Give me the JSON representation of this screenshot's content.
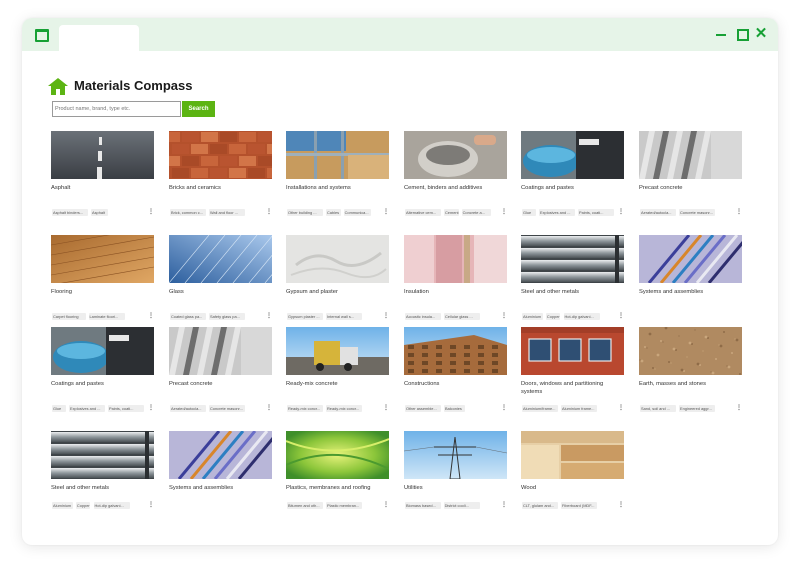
{
  "header": {
    "title": "Materials Compass"
  },
  "search": {
    "placeholder": "Product name, brand, type etc.",
    "button_label": "Search"
  },
  "window": {
    "close_glyph": "✕"
  },
  "more_glyph": "⋮",
  "categories": [
    {
      "label": "Asphalt",
      "image": "asphalt-image",
      "tags": [
        "Asphalt binders...",
        "Asphalt"
      ]
    },
    {
      "label": "Bricks and ceramics",
      "image": "bricks-image",
      "tags": [
        "Brick, common c...",
        "Wall and floor ..."
      ]
    },
    {
      "label": "Installations and systems",
      "image": "installations-image",
      "tags": [
        "Other building ...",
        "Cables",
        "Communica..."
      ]
    },
    {
      "label": "Cement, binders and additives",
      "image": "cement-image",
      "tags": [
        "Alternative cem...",
        "Cement",
        "Concrete a..."
      ]
    },
    {
      "label": "Coatings and pastes",
      "image": "paint-can-image",
      "tags": [
        "Glue",
        "Explosives and ...",
        "Paints, coati..."
      ]
    },
    {
      "label": "Precast concrete",
      "image": "precast-concrete-image",
      "tags": [
        "Aerated/autocla...",
        "Concrete masonr..."
      ]
    },
    {
      "label": "Flooring",
      "image": "flooring-image",
      "tags": [
        "Carpet flooring",
        "Laminate floori..."
      ]
    },
    {
      "label": "Glass",
      "image": "glass-facade-image",
      "tags": [
        "Coated glass pa...",
        "Safety glass pa..."
      ]
    },
    {
      "label": "Gypsum and plaster",
      "image": "plaster-image",
      "tags": [
        "Gypsum plaster ...",
        "Internal wall s..."
      ]
    },
    {
      "label": "Insulation",
      "image": "insulation-image",
      "tags": [
        "Acoustic insula...",
        "Cellular glass ..."
      ]
    },
    {
      "label": "Steel and other metals",
      "image": "steel-pipes-image",
      "tags": [
        "Aluminium",
        "Copper",
        "Hot-dip galvani..."
      ]
    },
    {
      "label": "Systems and assemblies",
      "image": "cables-image",
      "tags": []
    },
    {
      "label": "Coatings and pastes",
      "image": "paint-can-image",
      "tags": [
        "Glue",
        "Explosives and ...",
        "Paints, coati..."
      ]
    },
    {
      "label": "Precast concrete",
      "image": "precast-concrete-image",
      "tags": [
        "Aerated/autocla...",
        "Concrete masonr..."
      ]
    },
    {
      "label": "Ready-mix concrete",
      "image": "ready-mix-image",
      "tags": [
        "Ready-mix concr...",
        "Ready-mix concr..."
      ]
    },
    {
      "label": "Constructions",
      "image": "construction-image",
      "tags": [
        "Other assemble...",
        "Balconies"
      ]
    },
    {
      "label": "Doors, windows and partitioning systems",
      "image": "windows-image",
      "tags": [
        "Aluminium/frame...",
        "Aluminium frame..."
      ]
    },
    {
      "label": "Earth, masses and stones",
      "image": "earth-image",
      "tags": [
        "Sand, soil and ...",
        "Engineered aggr..."
      ]
    },
    {
      "label": "Steel and other metals",
      "image": "steel-pipes-image",
      "tags": [
        "Aluminium",
        "Copper",
        "Hot-dip galvani..."
      ]
    },
    {
      "label": "Systems and assemblies",
      "image": "cables-image",
      "tags": []
    },
    {
      "label": "Plastics, membranes and roofing",
      "image": "plastics-image",
      "tags": [
        "Bitumen and oth...",
        "Plastic membran..."
      ]
    },
    {
      "label": "Utilities",
      "image": "power-pylon-image",
      "tags": [
        "Biomass based...",
        "District cooli..."
      ]
    },
    {
      "label": "Wood",
      "image": "wood-image",
      "tags": [
        "CLT, glulam and...",
        "Fiberboard (MDF..."
      ]
    }
  ]
}
